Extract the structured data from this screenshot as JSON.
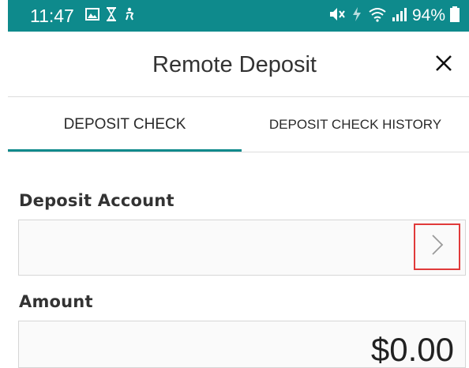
{
  "status_bar": {
    "time": "11:47",
    "battery": "94%",
    "left_icons": [
      "image-icon",
      "hourglass-icon",
      "accessibility-icon"
    ],
    "right_icons": [
      "mute-icon",
      "data-icon",
      "wifi-icon",
      "signal-icon",
      "battery-icon"
    ],
    "background_color": "#0e8a8c"
  },
  "header": {
    "title": "Remote Deposit",
    "close_icon": "close-icon"
  },
  "tabs": [
    {
      "label": "DEPOSIT CHECK",
      "active": true
    },
    {
      "label": "DEPOSIT CHECK HISTORY",
      "active": false
    }
  ],
  "form": {
    "deposit_account": {
      "label": "Deposit Account",
      "value": "",
      "icon": "chevron-right-icon",
      "highlight_color": "#e03a3a"
    },
    "amount": {
      "label": "Amount",
      "value": "$0.00"
    }
  },
  "accent_color": "#0e8a8c"
}
